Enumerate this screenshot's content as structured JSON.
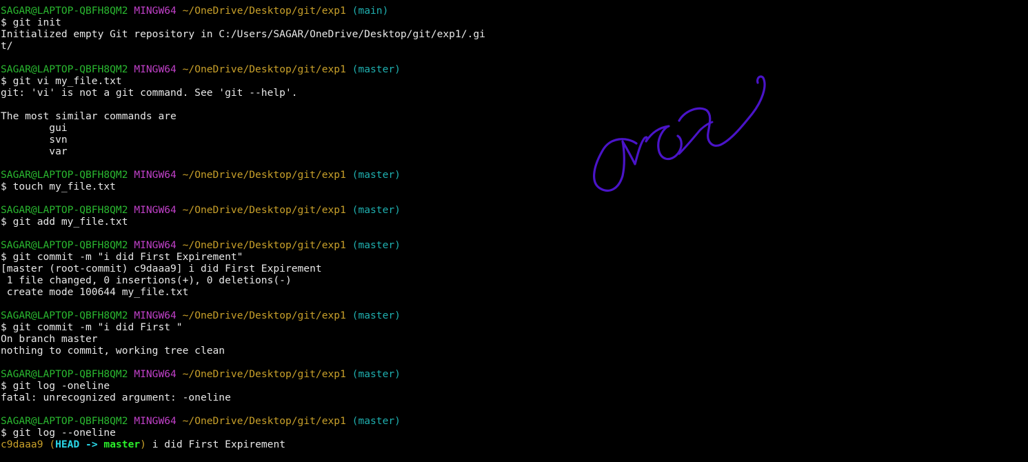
{
  "prompt": {
    "user_host": "SAGAR@LAPTOP-QBFH8QM2",
    "msystem": "MINGW64",
    "path": "~/OneDrive/Desktop/git/exp1",
    "branch_main": "(main)",
    "branch_master": "(master)"
  },
  "blocks": [
    {
      "branch_key": "branch_main",
      "command": "$ git init",
      "output": [
        "Initialized empty Git repository in C:/Users/SAGAR/OneDrive/Desktop/git/exp1/.gi",
        "t/"
      ]
    },
    {
      "branch_key": "branch_master",
      "command": "$ git vi my_file.txt",
      "output": [
        "git: 'vi' is not a git command. See 'git --help'.",
        "",
        "The most similar commands are",
        "        gui",
        "        svn",
        "        var"
      ]
    },
    {
      "branch_key": "branch_master",
      "command": "$ touch my_file.txt",
      "output": []
    },
    {
      "branch_key": "branch_master",
      "command": "$ git add my_file.txt",
      "output": []
    },
    {
      "branch_key": "branch_master",
      "command": "$ git commit -m \"i did First Expirement\"",
      "output": [
        "[master (root-commit) c9daaa9] i did First Expirement",
        " 1 file changed, 0 insertions(+), 0 deletions(-)",
        " create mode 100644 my_file.txt"
      ]
    },
    {
      "branch_key": "branch_master",
      "command": "$ git commit -m \"i did First \"",
      "output": [
        "On branch master",
        "nothing to commit, working tree clean"
      ]
    },
    {
      "branch_key": "branch_master",
      "command": "$ git log -oneline",
      "output": [
        "fatal: unrecognized argument: -oneline"
      ]
    },
    {
      "branch_key": "branch_master",
      "command": "$ git log --oneline",
      "output": []
    }
  ],
  "log_line": {
    "hash": "c9daaa9",
    "open_paren": "(",
    "head": "HEAD",
    "arrow": " -> ",
    "ref": "master",
    "close_paren": ")",
    "message": " i did First Expirement"
  },
  "colors": {
    "background": "#000000",
    "user_host": "#2ab930",
    "msystem": "#c040c8",
    "path": "#c8a02a",
    "branch": "#1fb0b0",
    "text": "#e8e8e8",
    "scribble": "#4a14c8"
  },
  "annotation": {
    "type": "handwritten-scribble",
    "color": "#4a14c8"
  }
}
